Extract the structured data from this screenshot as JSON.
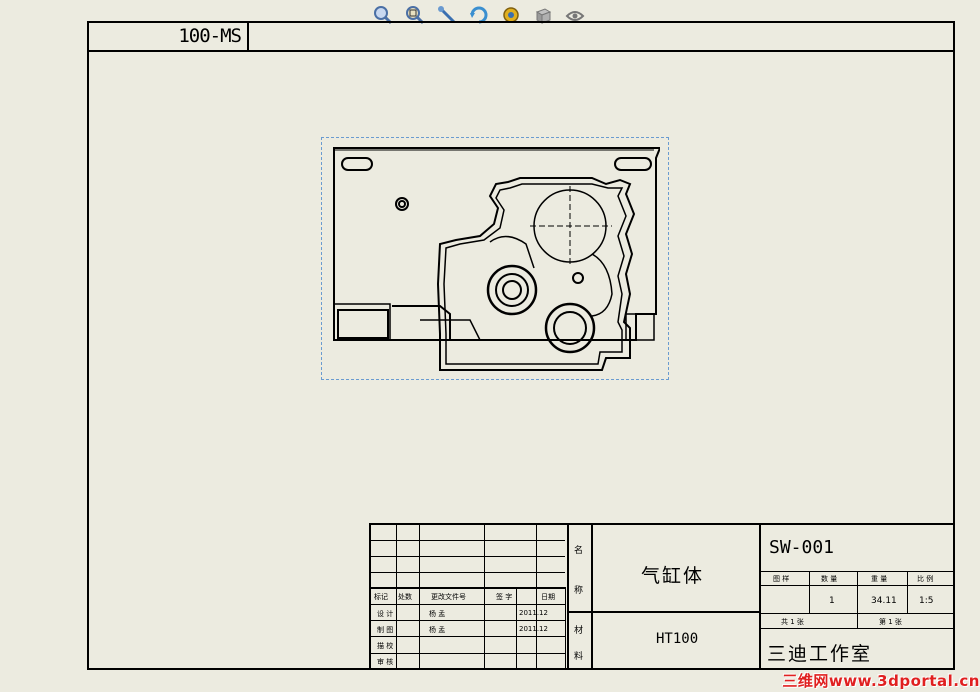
{
  "toolbar": {
    "icons": [
      "zoom-to-fit-icon",
      "zoom-area-icon",
      "sketch-icon",
      "rotate-icon",
      "display-style-icon",
      "view-orientation-icon",
      "hide-show-icon"
    ]
  },
  "sheet": {
    "drawing_number": "100-MS"
  },
  "title_block": {
    "part_name": "气缸体",
    "material": "HT100",
    "drawing_code": "SW-001",
    "company": "三迪工作室",
    "label_name_1": "名",
    "label_name_2": "称",
    "label_material_1": "材",
    "label_material_2": "料",
    "col_drawing_label": "图 样",
    "col_quantity_label": "数 量",
    "col_weight_label": "重 量",
    "col_scale_label": "比 例",
    "quantity": "1",
    "weight": "34.11",
    "scale": "1:5",
    "sheets_total_label": "共  1  张",
    "sheet_index_label": "第  1  张",
    "rev_headers": [
      "标记",
      "处数",
      "更改文件号",
      "签 字",
      "日期"
    ],
    "rows": [
      {
        "role": "设 计",
        "name": "杨 孟",
        "date": "2011.12"
      },
      {
        "role": "制 图",
        "name": "杨 孟",
        "date": "2011.12"
      },
      {
        "role": "描 校",
        "name": "",
        "date": ""
      },
      {
        "role": "审 核",
        "name": "",
        "date": ""
      }
    ]
  },
  "watermark": {
    "text": "三维网www.3dportal.cn"
  }
}
